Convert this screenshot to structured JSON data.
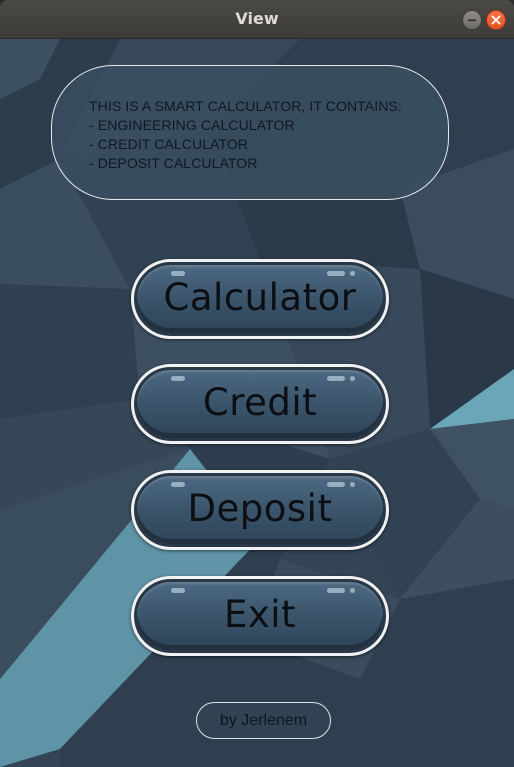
{
  "window": {
    "title": "View",
    "controls": [
      "minimize-icon",
      "close-icon"
    ]
  },
  "info_box": {
    "lines": [
      "THIS IS A SMART CALCULATOR, IT CONTAINS:",
      "- ENGINEERING CALCULATOR",
      "- CREDIT CALCULATOR",
      "- DEPOSIT CALCULATOR"
    ]
  },
  "buttons": {
    "calculator": "Calculator",
    "credit": "Credit",
    "deposit": "Deposit",
    "exit": "Exit"
  },
  "footer": {
    "author": "by Jerlenem"
  },
  "colors": {
    "background": "#334455",
    "button_fill": "#3c566d",
    "button_border": "#f2f2f2",
    "close_button": "#e95420",
    "accent_triangle": "#6aa5b8"
  }
}
